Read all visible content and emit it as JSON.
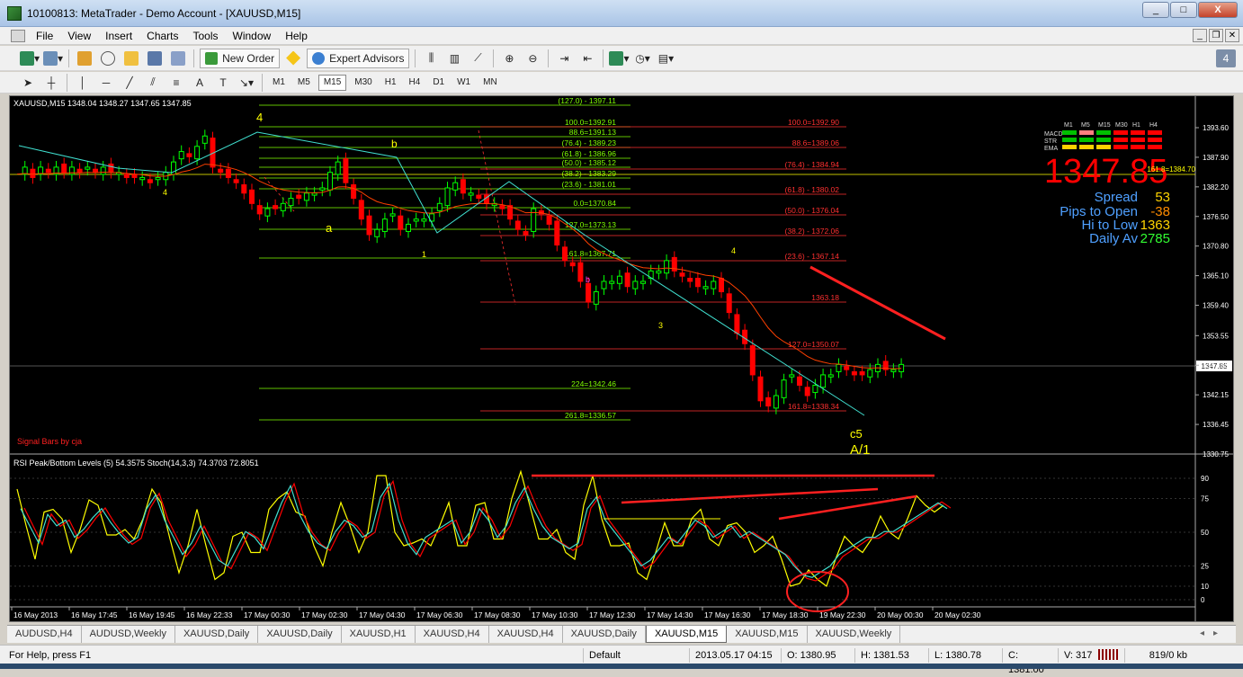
{
  "window": {
    "title": "10100813: MetaTrader - Demo Account - [XAUUSD,M15]",
    "controls": [
      "_",
      "□",
      "X"
    ]
  },
  "menu": [
    "File",
    "View",
    "Insert",
    "Charts",
    "Tools",
    "Window",
    "Help"
  ],
  "toolbar": {
    "new_order": "New Order",
    "expert_advisors": "Expert Advisors"
  },
  "timeframes": [
    "M1",
    "M5",
    "M15",
    "M30",
    "H1",
    "H4",
    "D1",
    "W1",
    "MN"
  ],
  "active_timeframe": "M15",
  "chart": {
    "header": "XAUUSD,M15  1348.04 1348.27 1347.65 1347.85",
    "signal_bars": "Signal Bars by cja",
    "current_price_big": "1347.85",
    "price_tag": "1347.85",
    "fib_tag": "161.8=1384.70",
    "price_ticks": [
      "1393.60",
      "1387.90",
      "1382.20",
      "1376.50",
      "1370.80",
      "1365.10",
      "1359.40",
      "1353.55",
      "1347.85",
      "1342.15",
      "1336.45",
      "1330.75"
    ],
    "info": {
      "spread_label": "Spread",
      "spread_value": "53",
      "pips_label": "Pips to Open",
      "pips_value": "-38",
      "hilo_label": "Hi to Low",
      "hilo_value": "1363",
      "daily_label": "Daily Av",
      "daily_value": "2785"
    },
    "signal_grid": {
      "timeframes": [
        "M1",
        "M5",
        "M15",
        "M30",
        "H1",
        "H4"
      ],
      "rows": [
        "MACD",
        "STR",
        "EMA"
      ]
    },
    "fib_left": [
      "(127.0) - 1397.11",
      "100.0=1392.91",
      "88.6=1391.13",
      "(76.4) - 1389.23",
      "(61.8) - 1386.96",
      "(50.0) - 1385.12",
      "(38.2) - 1383.29",
      "(23.6) - 1381.01",
      "0.0=1370.84",
      "127.0=1373.13",
      "161.8=1367.71",
      "224=1342.46",
      "261.8=1336.57"
    ],
    "fib_right": [
      "100.0=1392.90",
      "88.6=1389.06",
      "(76.4) - 1384.94",
      "(61.8) - 1380.02",
      "(50.0) - 1376.04",
      "(38.2) - 1372.06",
      "(23.6) - 1367.14",
      "1363.18",
      "127.0=1350.07",
      "161.8=1338.34"
    ],
    "wave_labels": [
      "4",
      "b",
      "4",
      "a",
      "1",
      "b",
      "4",
      "3",
      "c5",
      "A/1"
    ],
    "indicator_header": "RSI Peak/Bottom Levels (5)  54.3575  Stoch(14,3,3) 74.3703 72.8051",
    "indicator_ticks": [
      "90",
      "75",
      "50",
      "25",
      "10",
      "0"
    ],
    "time_labels": [
      "16 May 2013",
      "16 May 17:45",
      "16 May 19:45",
      "16 May 22:33",
      "17 May 00:30",
      "17 May 02:30",
      "17 May 04:30",
      "17 May 06:30",
      "17 May 08:30",
      "17 May 10:30",
      "17 May 12:30",
      "17 May 14:30",
      "17 May 16:30",
      "17 May 18:30",
      "19 May 22:30",
      "20 May 00:30",
      "20 May 02:30"
    ]
  },
  "tabs": [
    "AUDUSD,H4",
    "AUDUSD,Weekly",
    "XAUUSD,Daily",
    "XAUUSD,Daily",
    "XAUUSD,H1",
    "XAUUSD,H4",
    "XAUUSD,H4",
    "XAUUSD,Daily",
    "XAUUSD,M15",
    "XAUUSD,M15",
    "XAUUSD,Weekly"
  ],
  "active_tab": 8,
  "status": {
    "help": "For Help, press F1",
    "profile": "Default",
    "datetime": "2013.05.17 04:15",
    "open": "O: 1380.95",
    "high": "H: 1381.53",
    "low": "L: 1380.78",
    "close": "C: 1381.00",
    "volume": "V: 317",
    "traffic": "819/0 kb"
  },
  "colors": {
    "bull": "#00ff00",
    "bear": "#ff0000",
    "fib_green": "#7fff00",
    "fib_red": "#ff3030",
    "ema": "#ff4000",
    "yellow": "#ffff00",
    "cyan": "#40e0d0"
  }
}
